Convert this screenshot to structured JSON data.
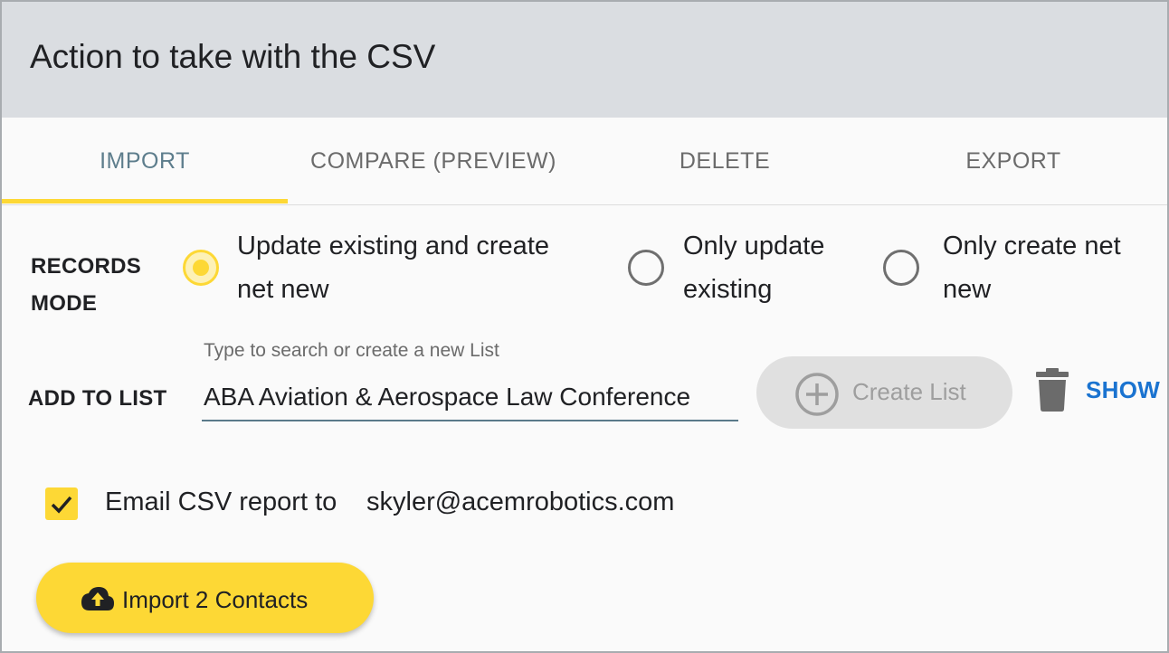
{
  "header": {
    "title": "Action to take with the CSV"
  },
  "tabs": [
    {
      "label": "IMPORT",
      "active": true
    },
    {
      "label": "COMPARE (PREVIEW)",
      "active": false
    },
    {
      "label": "DELETE",
      "active": false
    },
    {
      "label": "EXPORT",
      "active": false
    }
  ],
  "records_mode": {
    "label": "RECORDS MODE",
    "label_line1": "RECORDS",
    "label_line2": "MODE",
    "options": [
      {
        "line1": "Update existing and create",
        "line2": "net new",
        "checked": true
      },
      {
        "line1": "Only update",
        "line2": "existing",
        "checked": false
      },
      {
        "line1": "Only create net",
        "line2": "new",
        "checked": false
      }
    ]
  },
  "add_to_list": {
    "label": "ADD TO LIST",
    "hint": "Type to search or create a new List",
    "value": "ABA Aviation & Aerospace Law Conference",
    "create_label": "Create List",
    "show_label": "SHOW"
  },
  "email_report": {
    "checked": true,
    "label": "Email CSV report to",
    "email": "skyler@acemrobotics.com"
  },
  "import_button": {
    "label": "Import 2 Contacts"
  },
  "colors": {
    "accent": "#fdd835",
    "header_bg": "#dadde1",
    "active_tab": "#5d7d8c",
    "link": "#1a73d0"
  },
  "icons": {
    "create": "plus-circle-icon",
    "delete": "trash-icon",
    "checkbox": "check-icon",
    "import": "cloud-upload-icon"
  }
}
